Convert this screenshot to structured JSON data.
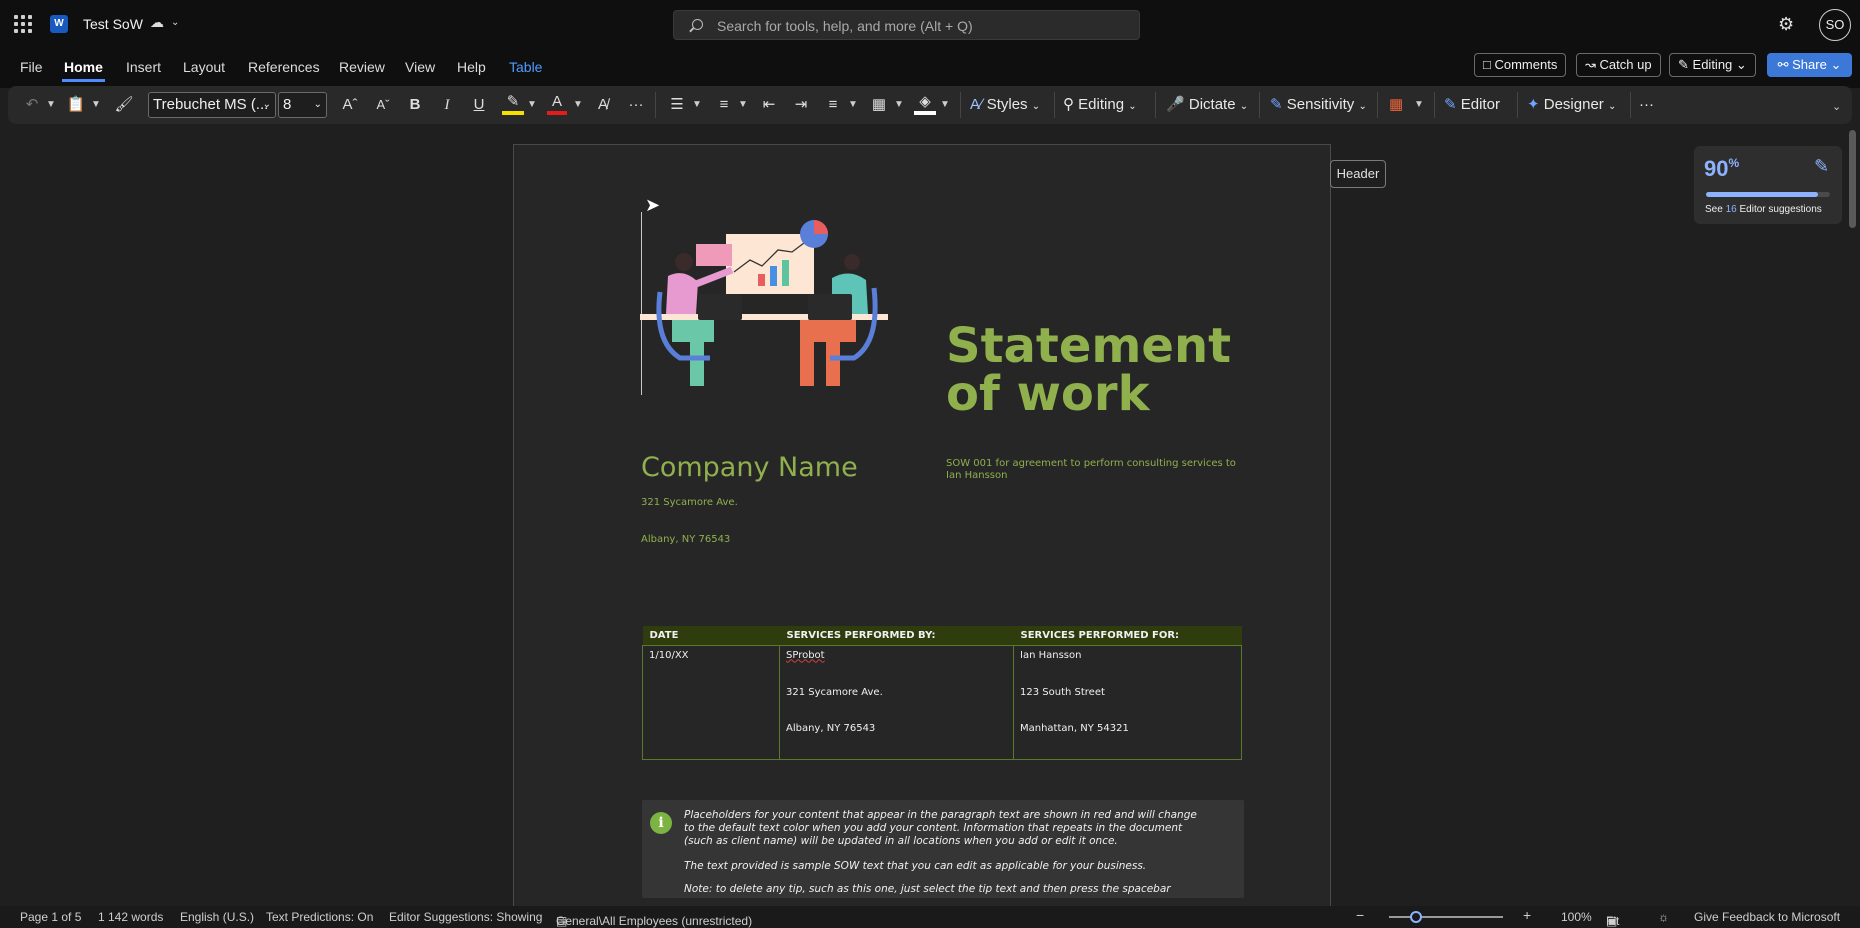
{
  "titlebar": {
    "doc_name": "Test SoW",
    "search_placeholder": "Search for tools, help, and more (Alt + Q)",
    "avatar_initials": "SO",
    "logo_letter": "W"
  },
  "menu": {
    "tabs": [
      "File",
      "Home",
      "Insert",
      "Layout",
      "References",
      "Review",
      "View",
      "Help",
      "Table"
    ],
    "active_tab": "Home",
    "comments_label": "Comments",
    "catchup_label": "Catch up",
    "editing_label": "Editing",
    "share_label": "Share"
  },
  "ribbon": {
    "font_name": "Trebuchet MS (...",
    "font_size": "8",
    "bold": "B",
    "italic": "I",
    "underline": "U",
    "styles_label": "Styles",
    "editing_label": "Editing",
    "dictate_label": "Dictate",
    "sensitivity_label": "Sensitivity",
    "editor_label": "Editor",
    "designer_label": "Designer",
    "more": "···"
  },
  "header_tag": "Header",
  "editor_panel": {
    "score": "90",
    "score_unit": "%",
    "score_fraction": 0.9,
    "see_label": "See",
    "count": "16",
    "suggestions_label": "Editor suggestions"
  },
  "document": {
    "title_line1": "Statement",
    "title_line2": "of work",
    "company": "Company Name",
    "sow_text": "SOW 001 for agreement to perform consulting services to Ian Hansson",
    "address_line1": "321 Sycamore Ave.",
    "address_line2": "Albany, NY 76543",
    "table": {
      "headers": [
        "DATE",
        "SERVICES PERFORMED BY:",
        "SERVICES PERFORMED FOR:"
      ],
      "date": "1/10/XX",
      "by": [
        "SProbot",
        "321 Sycamore Ave.",
        "Albany, NY 76543"
      ],
      "for": [
        "Ian Hansson",
        "123 South Street",
        "Manhattan, NY 54321"
      ]
    },
    "tip": {
      "icon": "i",
      "para1": "Placeholders for your content that appear in the paragraph text are shown in red and will change to the default text color when you add your content. Information that repeats in the document (such as client name) will be updated in all locations when you add or edit it once.",
      "para2": "The text provided is sample SOW text that you can edit as applicable for your business.",
      "para3": "Note: to delete any tip, such as this one, just select the tip text and then press the spacebar"
    }
  },
  "status": {
    "page": "Page 1 of 5",
    "words": "1 142 words",
    "language": "English (U.S.)",
    "predictions": "Text Predictions: On",
    "suggestions": "Editor Suggestions: Showing",
    "sensitivity": "General\\All Employees (unrestricted)",
    "zoom": "100%",
    "fit": "Fit",
    "feedback": "Give Feedback to Microsoft"
  },
  "colors": {
    "accent_green": "#8fb04d",
    "share_blue": "#3b78d8",
    "table_header_bg": "#2f3d0e"
  }
}
